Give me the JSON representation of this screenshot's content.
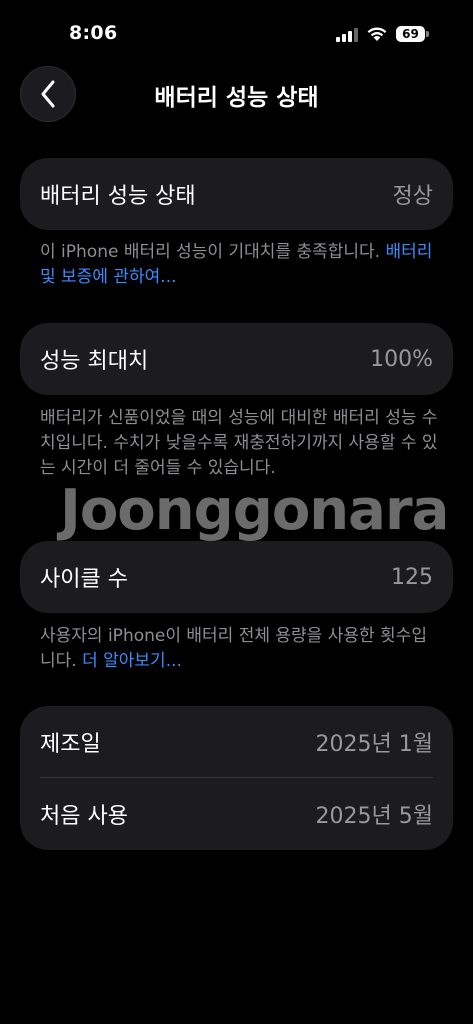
{
  "status_bar": {
    "time": "8:06",
    "battery_level": "69"
  },
  "nav": {
    "title": "배터리 성능 상태",
    "back_icon": "chevron-left-icon"
  },
  "health": {
    "label": "배터리 성능 상태",
    "value": "정상",
    "note": "이 iPhone 배터리 성능이 기대치를 충족합니다. ",
    "link": "배터리 및 보증에 관하여..."
  },
  "max_capacity": {
    "label": "성능 최대치",
    "value": "100%",
    "note": "배터리가 신품이었을 때의 성능에 대비한 배터리 성능 수치입니다. 수치가 낮을수록 재충전하기까지 사용할 수 있는 시간이 더 줄어들 수 있습니다."
  },
  "cycle_count": {
    "label": "사이클 수",
    "value": "125",
    "note": "사용자의 iPhone이 배터리 전체 용량을 사용한 횟수입니다. ",
    "link": "더 알아보기..."
  },
  "dates": {
    "manufacture_label": "제조일",
    "manufacture_value": "2025년 1월",
    "first_use_label": "처음 사용",
    "first_use_value": "2025년 5월"
  },
  "watermark": "Joonggonara",
  "colors": {
    "background": "#000000",
    "card": "#1c1c1e",
    "secondary_text": "#98989f",
    "link": "#3a8bfd"
  }
}
